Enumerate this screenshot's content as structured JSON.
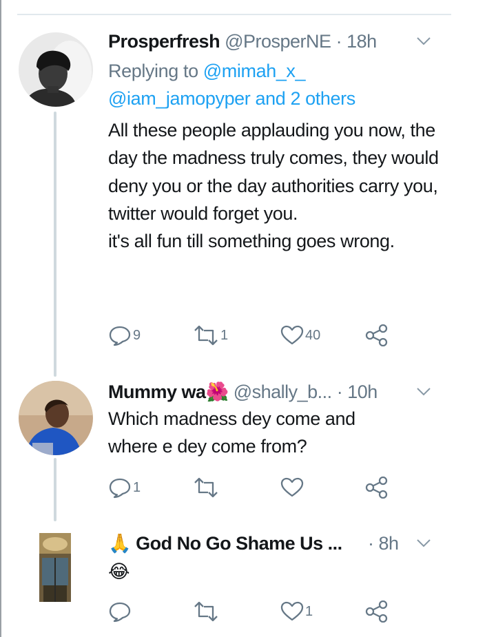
{
  "tweets": [
    {
      "name": "Prosperfresh",
      "handle": "@ProsperNE",
      "dot": "·",
      "time": "18h",
      "replying_prefix": "Replying to",
      "replying_first": "@mimah_x_",
      "replying_rest": "@iam_jamopyper and 2 others",
      "body": "All these people applauding you now, the day the madness truly comes, they would deny you or the day authorities carry you, twitter would forget you.\nit's all fun till something goes wrong.",
      "reply_count": "9",
      "retweet_count": "1",
      "like_count": "40"
    },
    {
      "name": "Mummy wa",
      "name_emoji": "🌺",
      "handle": "@shally_b...",
      "dot": "·",
      "time": "10h",
      "body": "Which madness dey come and where e dey come from?",
      "reply_count": "1",
      "retweet_count": "",
      "like_count": ""
    },
    {
      "name_prefix_emoji": "🙏",
      "name": "God No Go Shame Us ...",
      "dot": "·",
      "time": "8h",
      "body": "😂",
      "reply_count": "",
      "retweet_count": "",
      "like_count": "1"
    }
  ],
  "colors": {
    "text": "#14171a",
    "secondary": "#657786",
    "link": "#1da1f2",
    "thread_line": "#cfd9de"
  }
}
